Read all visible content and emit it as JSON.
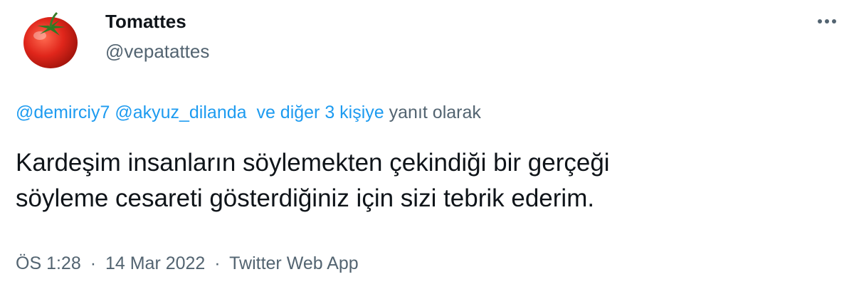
{
  "tweet": {
    "author": {
      "display_name": "Tomattes",
      "handle": "@vepatattes",
      "avatar_icon": "tomato-icon"
    },
    "more_icon": "more-dots-icon",
    "reply_to": {
      "mention_1": "@demirciy7",
      "mention_2": "@akyuz_dilanda",
      "others_link": "ve diğer 3 kişiye",
      "suffix": "yanıt olarak"
    },
    "text_lines": [
      "Kardeşim insanların söylemekten çekindiği bir gerçeği",
      "söyleme cesareti gösterdiğiniz için sizi tebrik ederim."
    ],
    "meta": {
      "time": "ÖS 1:28",
      "separator": "·",
      "date": "14 Mar 2022",
      "source": "Twitter Web App"
    },
    "colors": {
      "text": "#0f1419",
      "secondary": "#536471",
      "link": "#1d9bf0",
      "tomato": "#e0261b"
    }
  }
}
